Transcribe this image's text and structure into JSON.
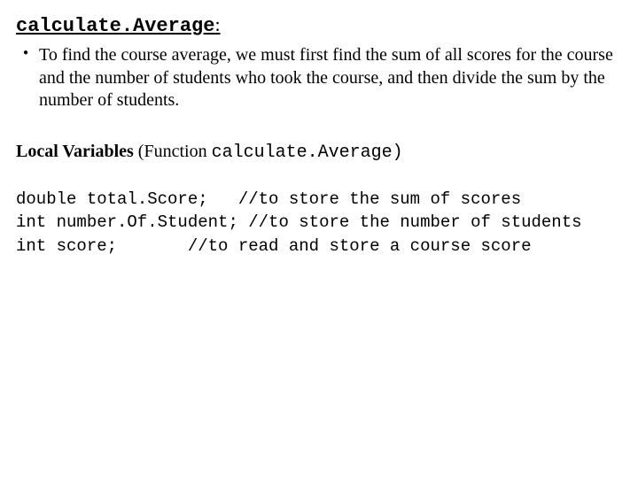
{
  "heading": {
    "function_name": "calculate.Average",
    "colon": ":"
  },
  "bullet": {
    "text": "To find the course average, we must first find the sum of all scores for the course and the number of students who took the course, and then divide the sum by the number of students."
  },
  "subheading": {
    "prefix": "Local Variables",
    "open": " (Function ",
    "fn": "calculate.Average)",
    "close": ""
  },
  "code": {
    "line1_decl": "double total.Score;   ",
    "line1_comment": "//to store the sum of scores",
    "line2_decl": "int number.Of.Student; ",
    "line2_comment": "//to store the number of students",
    "line3_decl": "int score;       ",
    "line3_comment": "//to read and store a course score"
  }
}
